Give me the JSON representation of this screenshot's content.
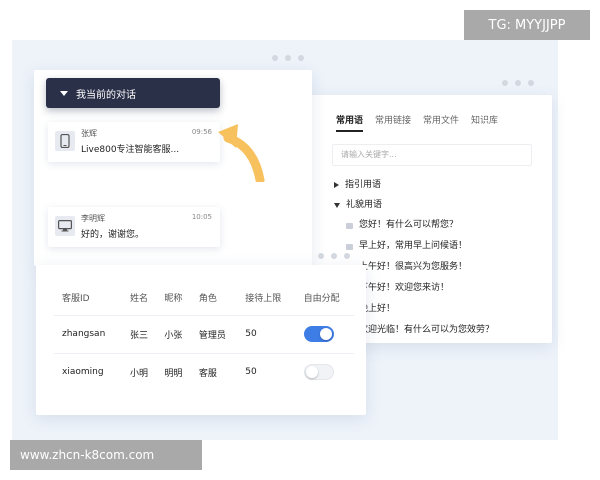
{
  "overlay": {
    "tg": "TG: MYYJJPP",
    "url": "www.zhcn-k8com.com"
  },
  "chat": {
    "header": "我当前的对话",
    "conversations": [
      {
        "name": "张辉",
        "time": "09:56",
        "message": "Live800专注智能客服...",
        "icon": "mobile-icon"
      },
      {
        "name": "李明辉",
        "time": "10:05",
        "message": "好的，谢谢您。",
        "icon": "desktop-icon"
      }
    ]
  },
  "phrases": {
    "tabs": [
      "常用语",
      "常用链接",
      "常用文件",
      "知识库"
    ],
    "search_placeholder": "请输入关键字...",
    "groups": [
      {
        "label": "指引用语",
        "expanded": false
      },
      {
        "label": "礼貌用语",
        "expanded": true
      }
    ],
    "items": [
      "您好！有什么可以帮您？",
      "早上好，常用早上问候语！",
      "上午好！很高兴为您服务！",
      "下午好！欢迎您来访！",
      "晚上好！",
      "欢迎光临！有什么可以为您效劳？"
    ]
  },
  "staff": {
    "columns": [
      "客服ID",
      "姓名",
      "昵称",
      "角色",
      "接待上限",
      "自由分配"
    ],
    "rows": [
      {
        "id": "zhangsan",
        "name": "张三",
        "nick": "小张",
        "role": "管理员",
        "limit": "50",
        "auto": true
      },
      {
        "id": "xiaoming",
        "name": "小明",
        "nick": "明明",
        "role": "客服",
        "limit": "50",
        "auto": false
      }
    ]
  },
  "colors": {
    "accent": "#3f7de6",
    "header_dark": "#2b3049",
    "arrow": "#f7c15e"
  }
}
